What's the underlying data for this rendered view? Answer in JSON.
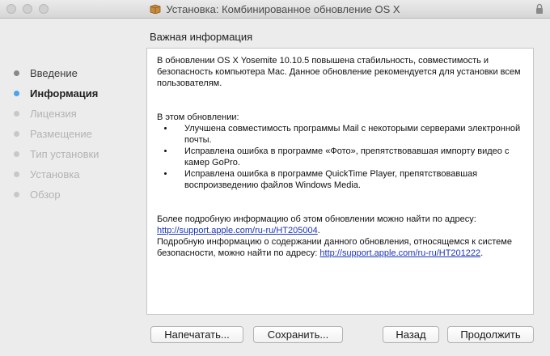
{
  "window": {
    "title": "Установка: Комбинированное обновление OS X"
  },
  "sidebar": {
    "steps": [
      {
        "label": "Введение",
        "state": "done"
      },
      {
        "label": "Информация",
        "state": "active"
      },
      {
        "label": "Лицензия",
        "state": "pending"
      },
      {
        "label": "Размещение",
        "state": "pending"
      },
      {
        "label": "Тип установки",
        "state": "pending"
      },
      {
        "label": "Установка",
        "state": "pending"
      },
      {
        "label": "Обзор",
        "state": "pending"
      }
    ]
  },
  "main": {
    "section_title": "Важная информация",
    "intro": "В обновлении OS X Yosemite 10.10.5 повышена стабильность, совместимость и безопасность компьютера Mac. Данное обновление рекомендуется для установки всем пользователям.",
    "list_heading": "В этом обновлении:",
    "bullets": [
      "Улучшена совместимость программы Mail с некоторыми серверами электронной почты.",
      "Исправлена ошибка в программе «Фото», препятствовавшая импорту видео с камер GoPro.",
      "Исправлена ошибка в программе QuickTime Player, препятствовавшая воспроизведению файлов Windows Media."
    ],
    "more_info_text": "Более подробную информацию об этом обновлении можно найти по адресу:",
    "more_info_link": "http://support.apple.com/ru-ru/HT205004",
    "security_text": "Подробную информацию о содержании данного обновления, относящемся к системе безопасности, можно найти по адресу:",
    "security_link": "http://support.apple.com/ru-ru/HT201222"
  },
  "buttons": {
    "print": "Напечатать...",
    "save": "Сохранить...",
    "back": "Назад",
    "continue": "Продолжить"
  },
  "colors": {
    "active_step_dot": "#4aa3f0",
    "link": "#1b36b8",
    "window_bg": "#ececec"
  }
}
